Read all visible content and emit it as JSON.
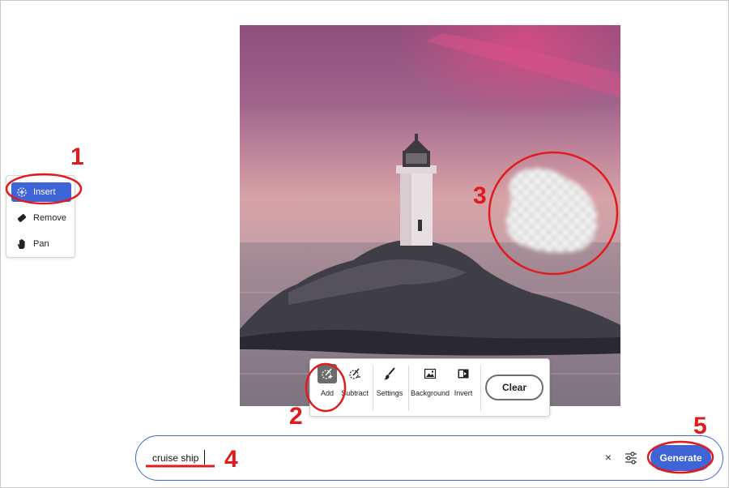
{
  "tool_panel": {
    "items": [
      {
        "label": "Insert",
        "icon": "insert-icon",
        "active": true
      },
      {
        "label": "Remove",
        "icon": "remove-icon",
        "active": false
      },
      {
        "label": "Pan",
        "icon": "hand-icon",
        "active": false
      }
    ]
  },
  "mini_toolbar": {
    "add_label": "Add",
    "subtract_label": "Subtract",
    "settings_label": "Settings",
    "background_label": "Background",
    "invert_label": "Invert",
    "clear_label": "Clear"
  },
  "prompt": {
    "value": "cruise ship",
    "clear_symbol": "×",
    "generate_label": "Generate"
  },
  "annotations": [
    "1",
    "2",
    "3",
    "4",
    "5"
  ],
  "colors": {
    "accent": "#3e64d8",
    "annotation_red": "#e11b1b"
  }
}
